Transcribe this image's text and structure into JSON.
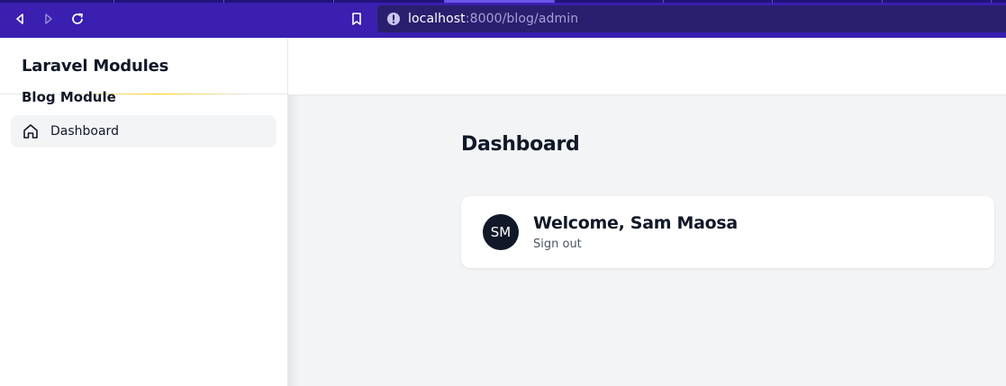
{
  "browser": {
    "url_host": "localhost",
    "url_path": ":8000/blog/admin"
  },
  "sidebar": {
    "brand": "Laravel Modules",
    "section_title": "Blog Module",
    "items": [
      {
        "label": "Dashboard",
        "icon": "home-icon"
      }
    ]
  },
  "main": {
    "title": "Dashboard",
    "card": {
      "initials": "SM",
      "welcome": "Welcome, Sam Maosa",
      "signout": "Sign out"
    }
  },
  "colors": {
    "browser_bar": "#3a1fb0",
    "url_box": "#2a1f6e",
    "avatar": "#111827",
    "page_bg": "#f3f4f6"
  }
}
